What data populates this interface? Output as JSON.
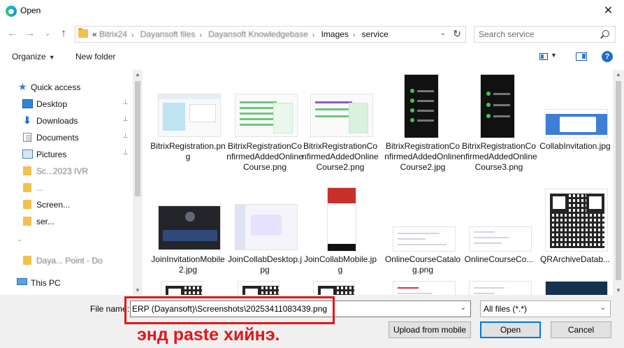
{
  "window": {
    "title": "Open",
    "close_glyph": "✕"
  },
  "nav": {
    "back_glyph": "←",
    "forward_glyph": "→",
    "dropdown_glyph": "⌄",
    "up_glyph": "↑"
  },
  "address": {
    "crumbs": [
      "«",
      "Bitrix24",
      "Dayansoft files",
      "Dayansoft Knowledgebase",
      "Images",
      "service"
    ],
    "refresh_glyph": "↻"
  },
  "search": {
    "placeholder": "Search service"
  },
  "toolbar": {
    "organize": "Organize",
    "new_folder": "New folder",
    "help": "?"
  },
  "sidebar": {
    "items": [
      {
        "label": "Quick access",
        "icon": "star-icon"
      },
      {
        "label": "Desktop",
        "icon": "desktop-icon",
        "pinned": true
      },
      {
        "label": "Downloads",
        "icon": "download-icon",
        "pinned": true
      },
      {
        "label": "Documents",
        "icon": "documents-icon",
        "pinned": true
      },
      {
        "label": "Pictures",
        "icon": "pictures-icon",
        "pinned": true
      },
      {
        "label": "Sc...2023 IVR",
        "icon": "folder-icon"
      },
      {
        "label": "...",
        "icon": "folder-icon"
      },
      {
        "label": "Screen...",
        "icon": "folder-icon"
      },
      {
        "label": "ser...",
        "icon": "folder-icon"
      },
      {
        "label": "-",
        "icon": "none"
      },
      {
        "label": "Daya...                    Point - Do",
        "icon": "folder-icon"
      },
      {
        "label": "This PC",
        "icon": "pc-icon"
      }
    ],
    "pin_glyph": "📌"
  },
  "files": [
    {
      "name": "BitrixRegistration.png",
      "kind": "web"
    },
    {
      "name": "BitrixRegistrationConfirmedAddedOnlineCourse.png",
      "kind": "list"
    },
    {
      "name": "BitrixRegistrationConfirmedAddedOnlineCourse2.png",
      "kind": "list"
    },
    {
      "name": "BitrixRegistrationConfirmedAddedOnlineCourse2.jpg",
      "kind": "phone"
    },
    {
      "name": "BitrixRegistrationConfirmedAddedOnlineCourse3.png",
      "kind": "phone"
    },
    {
      "name": "CollabInvitation.jpg",
      "kind": "invite"
    },
    {
      "name": "JoinInvitationMobile2.jpg",
      "kind": "dark"
    },
    {
      "name": "JoinCollabDesktop.jpg",
      "kind": "collab"
    },
    {
      "name": "JoinCollabMobile.jpg",
      "kind": "mobile"
    },
    {
      "name": "OnlineCourseCatalog.png",
      "kind": "simple"
    },
    {
      "name": "OnlineCourseCo...",
      "kind": "simple"
    },
    {
      "name": "QRArchiveDatab...",
      "kind": "qr"
    }
  ],
  "bottom": {
    "file_name_label": "File name:",
    "file_name_value": "ERP (Dayansoft)\\Screenshots\\20253411083439.png",
    "filter_value": "All files (*.*)",
    "upload_button": "Upload from mobile",
    "open_button": "Open",
    "cancel_button": "Cancel"
  },
  "annotation": {
    "text": "энд paste хийнэ.",
    "color": "#e3161b"
  }
}
